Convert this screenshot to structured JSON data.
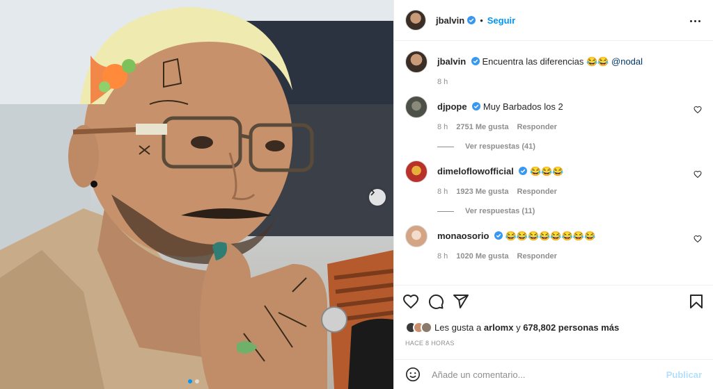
{
  "post": {
    "username": "jbalvin",
    "follow_label": "Seguir",
    "separator": "•",
    "caption_user": "jbalvin",
    "caption_text": "Encuentra las diferencias 😂😂 ",
    "caption_mention": "@nodal",
    "caption_time": "8 h"
  },
  "comments": [
    {
      "user": "djpope",
      "verified": true,
      "text": "Muy Barbados los 2",
      "time": "8 h",
      "likes": "2751 Me gusta",
      "reply": "Responder",
      "replies": "Ver respuestas (41)",
      "avatar_color": "#6b6f66"
    },
    {
      "user": "dimeloflowofficial",
      "verified": true,
      "text": "😂😂😂",
      "time": "8 h",
      "likes": "1923 Me gusta",
      "reply": "Responder",
      "replies": "Ver respuestas (11)",
      "avatar_color": "#c0392b"
    },
    {
      "user": "monaosorio",
      "verified": true,
      "text": "😂😂😂😂😂😂😂😂",
      "time": "8 h",
      "likes": "1020 Me gusta",
      "reply": "Responder",
      "replies": "",
      "avatar_color": "#d9b9a3"
    }
  ],
  "likes": {
    "prefix": "Les gusta a ",
    "user": "arlomx",
    "middle": " y ",
    "count": "678,802 personas más"
  },
  "timestamp": "HACE 8 HORAS",
  "composer": {
    "placeholder": "Añade un comentario...",
    "publish_label": "Publicar"
  },
  "colors": {
    "accent": "#0095f6",
    "verified": "#3897f0",
    "muted": "#8e8e8e",
    "publish_disabled": "#b2dffc"
  },
  "icons": [
    "next-arrow-icon",
    "more-options-icon",
    "verified-icon",
    "heart-icon",
    "comment-icon",
    "share-icon",
    "bookmark-icon",
    "emoji-icon"
  ],
  "carousel": {
    "count": 2,
    "active": 1
  }
}
